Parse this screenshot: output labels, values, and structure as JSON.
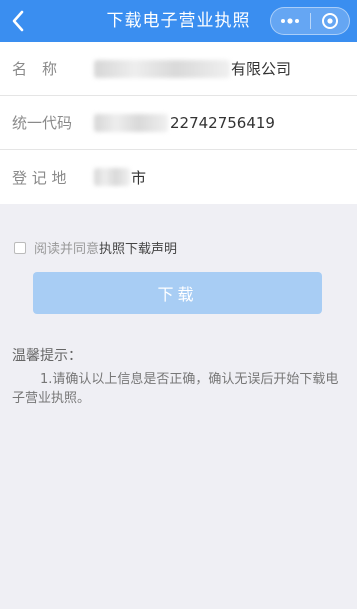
{
  "nav": {
    "title": "下载电子营业执照",
    "background": "#3a8ef0"
  },
  "fields": [
    {
      "label": "名　称",
      "value": "有限公司"
    },
    {
      "label": "统一代码",
      "value": "22742756419"
    },
    {
      "label": "登 记 地",
      "value": "市"
    }
  ],
  "agreement": {
    "prefix": "阅读并同意",
    "link": "执照下载声明",
    "checked": false
  },
  "download": {
    "label": "下载",
    "color": "#a8cdf4"
  },
  "tips": {
    "title": "温馨提示：",
    "body": "1.请确认以上信息是否正确，确认无误后开始下载电子营业执照。"
  }
}
